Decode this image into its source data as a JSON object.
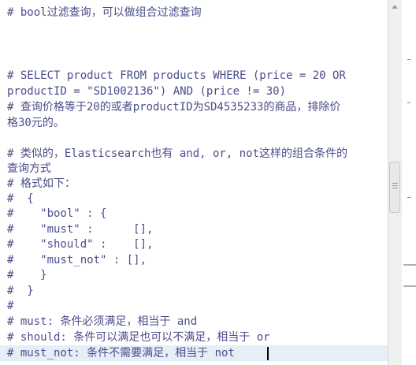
{
  "editor": {
    "lines": [
      "# bool过滤查询，可以做组合过滤查询",
      "",
      "",
      "",
      "# SELECT product FROM products WHERE (price = 20 OR",
      "productID = \"SD1002136\") AND (price != 30)",
      "# 查询价格等于20的或者productID为SD4535233的商品，排除价",
      "格30元的。",
      "",
      "# 类似的，Elasticsearch也有 and, or, not这样的组合条件的",
      "查询方式",
      "# 格式如下：",
      "#  {",
      "#    \"bool\" : {",
      "#    \"must\" :      [],",
      "#    \"should\" :    [],",
      "#    \"must_not\" : [],",
      "#    }",
      "#  }",
      "#",
      "# must: 条件必须满足，相当于 and",
      "# should: 条件可以满足也可以不满足，相当于 or",
      "# must_not: 条件不需要满足，相当于 not"
    ],
    "highlighted_line": 22,
    "text_color": "#4a4d8a",
    "highlight_color": "#e6eef8"
  }
}
